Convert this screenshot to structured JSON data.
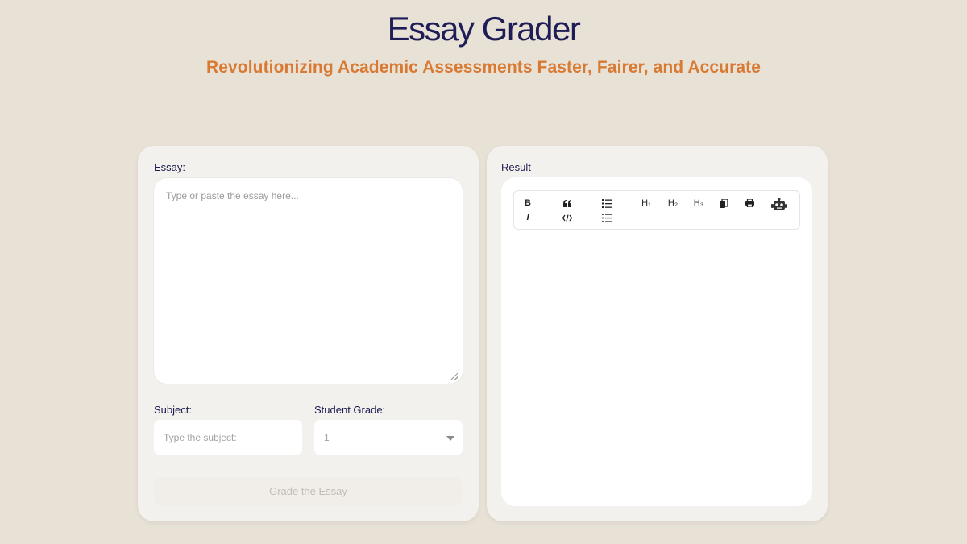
{
  "header": {
    "title": "Essay Grader",
    "subtitle": "Revolutionizing Academic Assessments Faster, Fairer, and Accurate"
  },
  "form": {
    "essay_label": "Essay:",
    "essay_placeholder": "Type or paste the essay here...",
    "subject_label": "Subject:",
    "subject_placeholder": "Type the subject:",
    "grade_label": "Student Grade:",
    "grade_value": "1",
    "submit_label": "Grade the Essay"
  },
  "result": {
    "label": "Result",
    "toolbar": {
      "bold": "B",
      "italic": "I",
      "h1": "H₁",
      "h2": "H₂",
      "h3": "H₃"
    }
  },
  "colors": {
    "background": "#e8e1d6",
    "title": "#1f1d55",
    "subtitle": "#d97a33",
    "panel": "#f3f1ed"
  }
}
